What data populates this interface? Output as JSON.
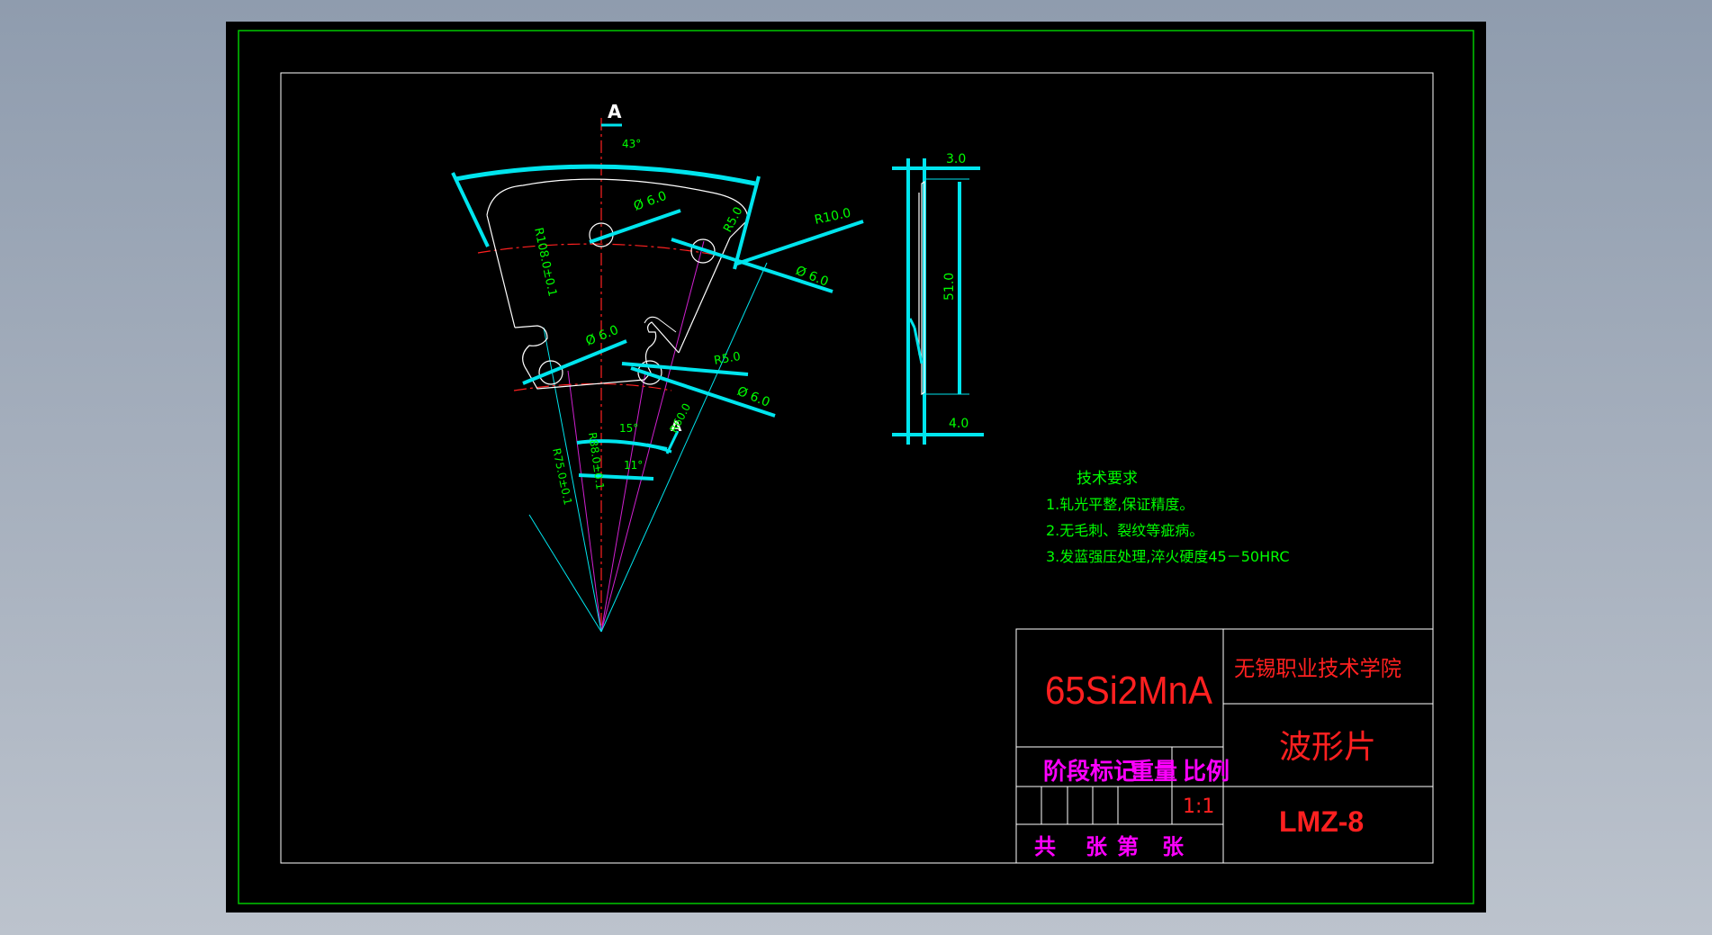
{
  "drawing": {
    "section_label_top": "A",
    "section_label_bottom": "A",
    "dimensions": {
      "angle_outer": "43°",
      "angle_mid": "15°",
      "angle_inner": "11°",
      "hole_top_left": "Ø 6.0",
      "hole_top_right": "Ø 6.0",
      "hole_mid_left": "Ø 6.0",
      "hole_mid_right": "Ø 6.0",
      "radius_outer_corner": "R5.0",
      "radius_outer": "R10.0",
      "radius_inner_corner": "R5.0",
      "radius_inner": "R60.0",
      "radius_big": "R108.0±0.1",
      "radius_small": "R75.0±0.1",
      "radius_center": "R88.0±0.1",
      "thickness": "3.0",
      "height": "51.0",
      "offset": "4.0"
    },
    "tech_requirements": {
      "title": "技术要求",
      "item1": "1.轧光平整,保证精度。",
      "item2": "2.无毛刺、裂纹等疵病。",
      "item3": "3.发蓝强压处理,淬火硬度45－50HRC"
    },
    "title_block": {
      "material": "65Si2MnA",
      "school": "无锡职业技术学院",
      "part_name": "波形片",
      "drawing_no": "LMZ-8",
      "stage_mark": "阶段标记",
      "weight": "重量",
      "scale_label": "比例",
      "scale_value": "1:1",
      "sheet_total_1": "共",
      "sheet_total_2": "张",
      "sheet_no_1": "第",
      "sheet_no_2": "张"
    },
    "colors": {
      "sheet_bg": "#000000",
      "frame_outer": "#00c800",
      "frame_inner": "#ffffff",
      "dimension": "#00e5ee",
      "dim_text": "#00ff00",
      "center_line": "#ff2020",
      "construction": "#d020d0",
      "title_red": "#ff2020",
      "title_magenta": "#ff00ff"
    }
  }
}
